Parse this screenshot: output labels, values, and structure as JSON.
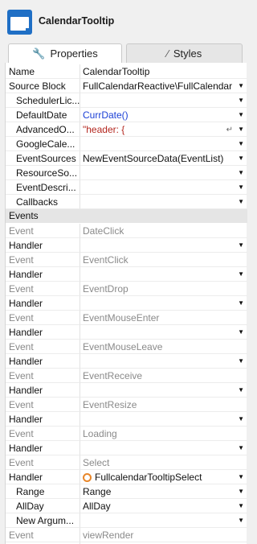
{
  "header": {
    "title": "CalendarTooltip"
  },
  "tabs": {
    "properties": "Properties",
    "styles": "Styles"
  },
  "properties": [
    {
      "label": "Name",
      "value": "CalendarTooltip",
      "indent": false,
      "dropdown": false,
      "style": ""
    },
    {
      "label": "Source Block",
      "value": "FullCalendarReactive\\FullCalendar",
      "indent": false,
      "dropdown": true,
      "style": ""
    },
    {
      "label": "SchedulerLic...",
      "value": "",
      "indent": true,
      "dropdown": true,
      "style": ""
    },
    {
      "label": "DefaultDate",
      "value": "CurrDate()",
      "indent": true,
      "dropdown": true,
      "style": "blue"
    },
    {
      "label": "AdvancedO...",
      "value": "\"header: {",
      "indent": true,
      "dropdown": true,
      "style": "red",
      "return_icon": "↵"
    },
    {
      "label": "GoogleCale...",
      "value": "",
      "indent": true,
      "dropdown": true,
      "style": ""
    },
    {
      "label": "EventSources",
      "value": "NewEventSourceData(EventList)",
      "indent": true,
      "dropdown": true,
      "style": ""
    },
    {
      "label": "ResourceSo...",
      "value": "",
      "indent": true,
      "dropdown": true,
      "style": ""
    },
    {
      "label": "EventDescri...",
      "value": "",
      "indent": true,
      "dropdown": true,
      "style": ""
    },
    {
      "label": "Callbacks",
      "value": "",
      "indent": true,
      "dropdown": true,
      "style": ""
    }
  ],
  "events_section": "Events",
  "events": [
    {
      "event_label": "Event",
      "event": "DateClick",
      "handler_label": "Handler",
      "handler": "",
      "handler_icon": false
    },
    {
      "event_label": "Event",
      "event": "EventClick",
      "handler_label": "Handler",
      "handler": "",
      "handler_icon": false
    },
    {
      "event_label": "Event",
      "event": "EventDrop",
      "handler_label": "Handler",
      "handler": "",
      "handler_icon": false
    },
    {
      "event_label": "Event",
      "event": "EventMouseEnter",
      "handler_label": "Handler",
      "handler": "",
      "handler_icon": false
    },
    {
      "event_label": "Event",
      "event": "EventMouseLeave",
      "handler_label": "Handler",
      "handler": "",
      "handler_icon": false
    },
    {
      "event_label": "Event",
      "event": "EventReceive",
      "handler_label": "Handler",
      "handler": "",
      "handler_icon": false
    },
    {
      "event_label": "Event",
      "event": "EventResize",
      "handler_label": "Handler",
      "handler": "",
      "handler_icon": false
    },
    {
      "event_label": "Event",
      "event": "Loading",
      "handler_label": "Handler",
      "handler": "",
      "handler_icon": false
    },
    {
      "event_label": "Event",
      "event": "Select",
      "handler_label": "Handler",
      "handler": "FullcalendarTooltipSelect",
      "handler_icon": true,
      "params": [
        {
          "label": "Range",
          "value": "Range"
        },
        {
          "label": "AllDay",
          "value": "AllDay"
        },
        {
          "label": "New Argum...",
          "value": ""
        }
      ]
    },
    {
      "event_label": "Event",
      "event": "viewRender",
      "handler_label": "Handler",
      "handler": "",
      "handler_icon": false
    }
  ],
  "icons": {
    "app": "calendar-widget-icon",
    "properties_tab": "wrench-icon",
    "styles_tab": "brush-icon",
    "dropdown": "caret-down-icon",
    "handler": "action-circle-icon"
  },
  "colors": {
    "accent": "#1f6fc5",
    "expression_blue": "#1a3fd6",
    "string_red": "#b3261e",
    "action_orange": "#e8862a"
  }
}
